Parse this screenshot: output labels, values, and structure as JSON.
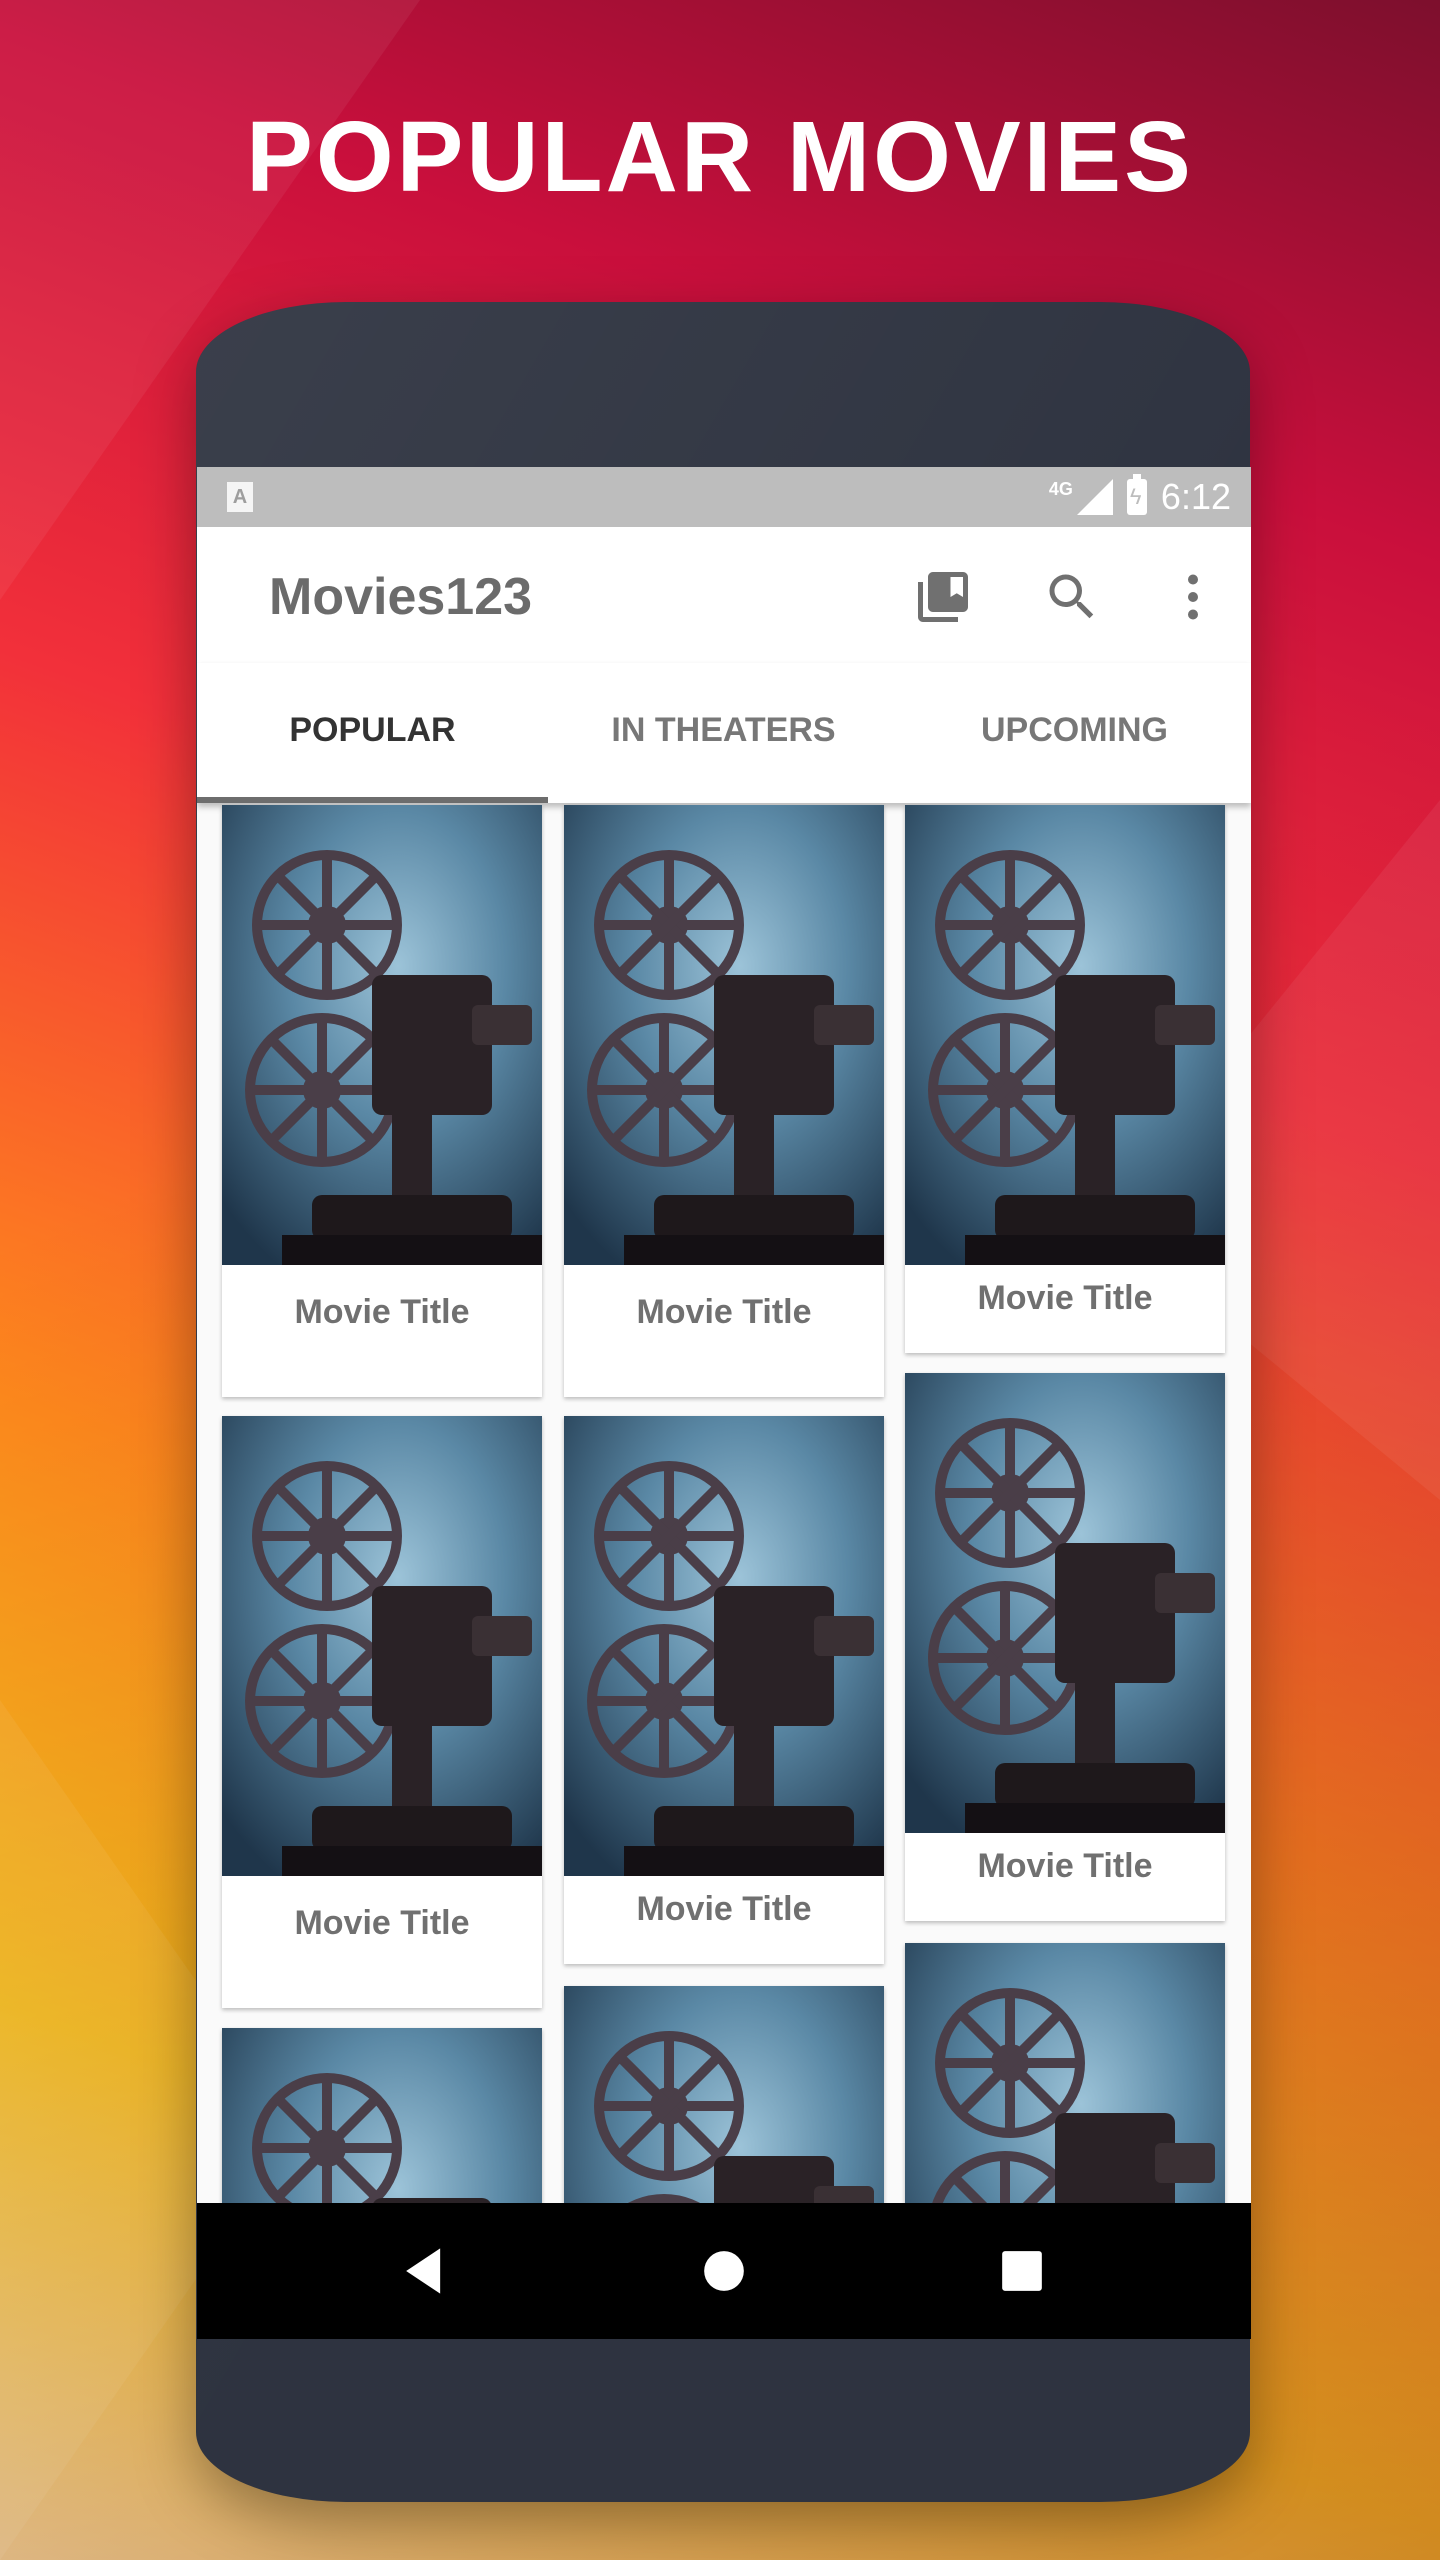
{
  "headline": "POPULAR MOVIES",
  "statusbar": {
    "network": "4G",
    "time": "6:12",
    "app_icon": "A"
  },
  "appbar": {
    "title": "Movies123",
    "icons": [
      "library-icon",
      "search-icon",
      "more-vert-icon"
    ]
  },
  "tabs": [
    {
      "label": "POPULAR",
      "active": true
    },
    {
      "label": "IN THEATERS",
      "active": false
    },
    {
      "label": "UPCOMING",
      "active": false
    }
  ],
  "movies": [
    {
      "title": "Movie Title"
    },
    {
      "title": "Movie Title"
    },
    {
      "title": "Movie Title"
    },
    {
      "title": "Movie Title"
    },
    {
      "title": "Movie Title"
    },
    {
      "title": "Movie Title"
    },
    {
      "title": ""
    },
    {
      "title": ""
    },
    {
      "title": ""
    }
  ],
  "navbar": {
    "buttons": [
      "back-icon",
      "home-icon",
      "recents-icon"
    ]
  },
  "colors": {
    "accent": "#6d6d6d",
    "phone_body": "#2e3340",
    "background_start": "#ffd21a",
    "background_end": "#c90f3c"
  }
}
